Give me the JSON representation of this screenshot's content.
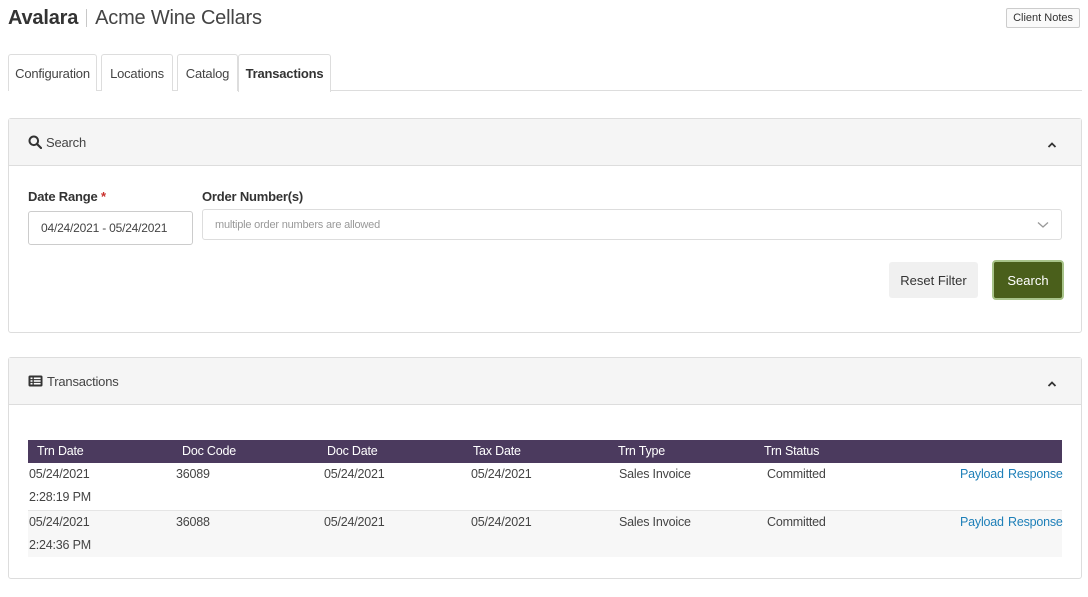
{
  "header": {
    "brand": "Avalara",
    "client_name": "Acme Wine Cellars",
    "client_notes_label": "Client Notes"
  },
  "tabs": [
    {
      "label": "Configuration",
      "active": false
    },
    {
      "label": "Locations",
      "active": false
    },
    {
      "label": "Catalog",
      "active": false
    },
    {
      "label": "Transactions",
      "active": true
    }
  ],
  "search_panel": {
    "title": "Search",
    "date_range_label": "Date Range",
    "required_mark": "*",
    "date_range_value": "04/24/2021 - 05/24/2021",
    "order_numbers_label": "Order Number(s)",
    "order_numbers_placeholder": "multiple order numbers are allowed",
    "reset_label": "Reset Filter",
    "search_label": "Search"
  },
  "transactions_panel": {
    "title": "Transactions",
    "columns": [
      "Trn Date",
      "Doc Code",
      "Doc Date",
      "Tax Date",
      "Trn Type",
      "Trn Status"
    ],
    "rows": [
      {
        "trn_date": "05/24/2021",
        "trn_time": "2:28:19 PM",
        "doc_code": "36089",
        "doc_date": "05/24/2021",
        "tax_date": "05/24/2021",
        "trn_type": "Sales Invoice",
        "trn_status": "Committed",
        "payload_label": "Payload",
        "response_label": "Response"
      },
      {
        "trn_date": "05/24/2021",
        "trn_time": "2:24:36 PM",
        "doc_code": "36088",
        "doc_date": "05/24/2021",
        "tax_date": "05/24/2021",
        "trn_type": "Sales Invoice",
        "trn_status": "Committed",
        "payload_label": "Payload",
        "response_label": "Response"
      }
    ]
  },
  "colors": {
    "table_header": "#4b3a5e",
    "search_button": "#4a5f1b",
    "link": "#1e7fb8",
    "required": "#c9302c"
  }
}
